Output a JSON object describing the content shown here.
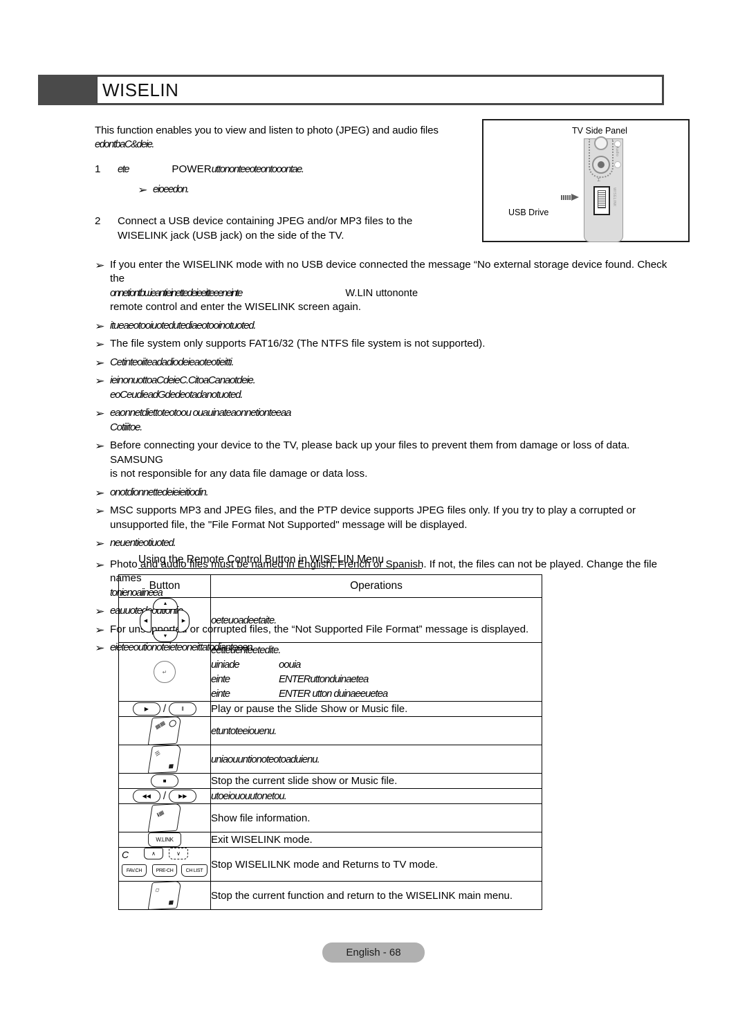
{
  "page": {
    "header_title": "WISELIN",
    "footer_badge": "English - 68"
  },
  "intro": {
    "line1": "This function enables you to view and listen to photo (JPEG) and audio files",
    "line2_garbled": "edontbaC&deie."
  },
  "steps": [
    {
      "num": "1",
      "prefix_garbled": "ete",
      "text_main": "POWER",
      "text_garbled": "uttononteeoteontooontae.",
      "sub_garbled": "eioeedon."
    },
    {
      "num": "2",
      "line1": "Connect a USB device containing JPEG and/or MP3 files to the",
      "line2": "WISELINK jack (USB jack) on the side of the TV."
    }
  ],
  "figure": {
    "title": "TV Side Panel",
    "usb_label": "USB Drive",
    "audio_label": "Audio",
    "wlink_label": "WISELINK"
  },
  "bullets": [
    {
      "style": "normal",
      "lines": [
        "If you enter the WISELINK mode with no USB device connected the message “No external storage device found. Check the"
      ],
      "garbled_line": "onnetiontbu.ieantieinettedeieeitteeeneinte",
      "right_text": "W.LIN   uttononte",
      "tail": "remote control and enter the WISELINK screen again."
    },
    {
      "style": "italic",
      "lines": [
        "itueaeotooiuotedutediaeotooinotuoted."
      ]
    },
    {
      "style": "normal",
      "lines": [
        "The file system only supports FAT16/32 (The NTFS file system is not supported)."
      ]
    },
    {
      "style": "italic",
      "lines": [
        "Cetinteoiiteadadiodeieaoteotieitti."
      ]
    },
    {
      "style": "italic",
      "lines": [
        "ieinonuottoaCdeieC.CitoaCanaotdeie.",
        "eoCeudieadGdedeotadanotuoted."
      ]
    },
    {
      "style": "italic",
      "lines": [
        "eaonnetdiettoteotoou ouauinateaonnetionteeaa",
        "Cotiiitoe."
      ]
    },
    {
      "style": "normal",
      "lines": [
        "Before connecting your device to the TV, please back up your files to prevent them from damage or loss of data. SAMSUNG",
        "is not responsible for any data file damage or data loss."
      ]
    },
    {
      "style": "italic",
      "lines": [
        "onotdionnettedeieieitiodin."
      ]
    },
    {
      "style": "normal",
      "lines": [
        "MSC supports MP3 and JPEG files, and the PTP device supports JPEG files only. If you try to play a corrupted or",
        "unsupported file, the \"File Format Not Supported\" message will be displayed."
      ]
    },
    {
      "style": "italic",
      "lines": [
        "neuentieotiuoted."
      ]
    },
    {
      "style": "normal",
      "lines": [
        "Photo and audio files must be named in English, French or Spanish. If not, the files can not be played. Change the file names"
      ],
      "garbled_line": "tonienoaiineea"
    },
    {
      "style": "italic",
      "lines": [
        "eauuotedeoutioniie."
      ]
    },
    {
      "style": "normal",
      "lines": [
        "For unsupported or corrupted files, the “Not Supported File Format” message is displayed."
      ]
    },
    {
      "style": "italic",
      "lines": [
        "eieteeoutionoteieteoneittatodianteeen."
      ]
    }
  ],
  "subtitle": "Using the Remote Control Button in WISELIN Menu",
  "table": {
    "headers": [
      "Button",
      "Operations"
    ],
    "rows": [
      {
        "icon": "dpad-icon",
        "op_italic": true,
        "op_text": "oeteuoadeetaite."
      },
      {
        "icon": "enter-button-icon",
        "op_italic": true,
        "op_lines": [
          "eetteuenteetedite."
        ],
        "op_pairs": [
          {
            "k": "uiniade",
            "v": "oouia"
          },
          {
            "k": "einte",
            "v": "ENTERuttonduinaetea"
          },
          {
            "k": "einte",
            "v": "ENTER utton  duinaeeuetea"
          }
        ]
      },
      {
        "icon": "play-pause-icon",
        "op_italic": false,
        "op_text": "Play or pause the Slide Show or Music file."
      },
      {
        "icon": "tools-key-icon",
        "op_italic": true,
        "op_text": "etuntoteeiouenu."
      },
      {
        "icon": "menu-key-icon",
        "op_italic": true,
        "op_text": "uniaouuntionoteotoaduienu."
      },
      {
        "icon": "stop-icon",
        "op_italic": false,
        "op_text": "Stop the current slide show or Music file."
      },
      {
        "icon": "rewind-fastforward-icon",
        "op_italic": true,
        "op_text": "utoeiououutonetou."
      },
      {
        "icon": "info-key-icon",
        "op_italic": false,
        "op_text": "Show file information."
      },
      {
        "icon": "wlink-key-icon",
        "op_italic": false,
        "op_text": "Exit WISELINK mode."
      },
      {
        "icon": "channel-keys-icon",
        "op_italic": false,
        "op_text": "Stop WISELILNK mode and Returns to TV mode."
      },
      {
        "icon": "return-key-icon",
        "op_italic": false,
        "op_text": "Stop the current function and return to the WISELINK main menu."
      }
    ]
  },
  "icon_labels": {
    "play": "▶",
    "pause": "‖",
    "stop": "■",
    "rewind": "◀◀",
    "forward": "▶▶",
    "up_arrow": "▲",
    "down_arrow": "▼",
    "left_arrow": "◀",
    "right_arrow": "▶",
    "chev_up": "∧",
    "chev_down": "∨",
    "enter": "↵",
    "wlink": "W.LINK",
    "fav_ch": "FAV.CH",
    "pre_ch": "PRE-CH",
    "ch_list": "CH LIST",
    "c_letter": "C",
    "bullet": "➢"
  }
}
